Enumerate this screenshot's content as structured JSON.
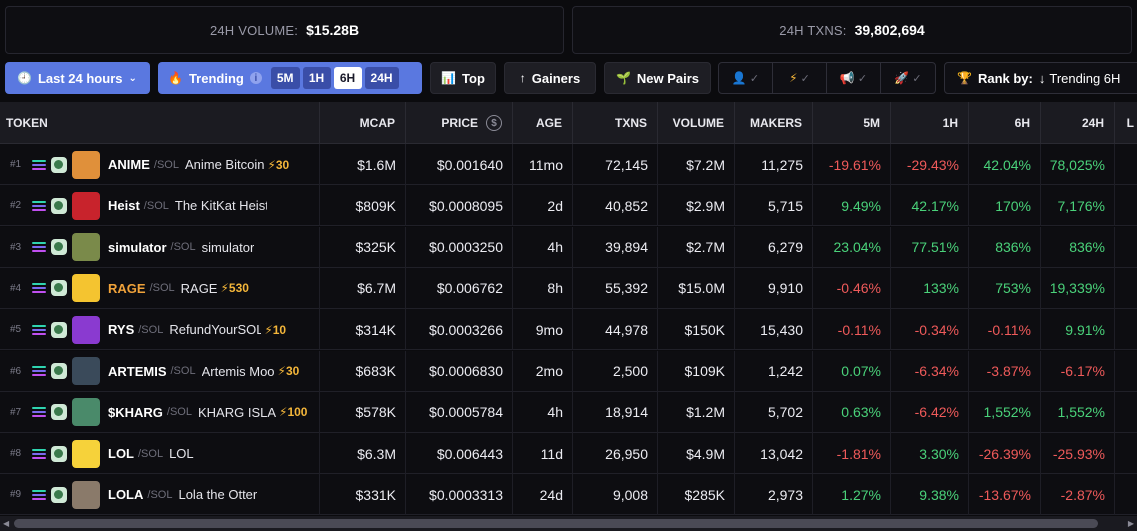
{
  "stats": {
    "volume_label": "24H VOLUME:",
    "volume_value": "$15.28B",
    "txns_label": "24H TXNS:",
    "txns_value": "39,802,694"
  },
  "toolbar": {
    "range_label": "Last 24 hours",
    "trending_label": "Trending",
    "trending_periods": [
      "5M",
      "1H",
      "6H",
      "24H"
    ],
    "trending_active": "6H",
    "top_label": "Top",
    "gainers_label": "Gainers",
    "new_pairs_label": "New Pairs",
    "rank_by_label": "Rank by:",
    "rank_by_value": "Trending 6H"
  },
  "table": {
    "columns": [
      "TOKEN",
      "MCAP",
      "PRICE",
      "AGE",
      "TXNS",
      "VOLUME",
      "MAKERS",
      "5M",
      "1H",
      "6H",
      "24H",
      "L"
    ],
    "rows": [
      {
        "rank": "#1",
        "symbol": "ANIME",
        "chain": "/SOL",
        "name": "Anime Bitcoin",
        "boost": "⚡30",
        "mcap": "$1.6M",
        "price": "$0.001640",
        "age": "11mo",
        "txns": "72,145",
        "volume": "$7.2M",
        "makers": "11,275",
        "m5": "-19.61%",
        "h1": "-29.43%",
        "h6": "42.04%",
        "h24": "78,025%",
        "avatar_color": "#e0903a"
      },
      {
        "rank": "#2",
        "symbol": "Heist",
        "chain": "/SOL",
        "name": "The KitKat Heist",
        "boost": "",
        "mcap": "$809K",
        "price": "$0.0008095",
        "age": "2d",
        "txns": "40,852",
        "volume": "$2.9M",
        "makers": "5,715",
        "m5": "9.49%",
        "h1": "42.17%",
        "h6": "170%",
        "h24": "7,176%",
        "avatar_color": "#c8232c"
      },
      {
        "rank": "#3",
        "symbol": "simulator",
        "chain": "/SOL",
        "name": "simulator",
        "boost": "",
        "mcap": "$325K",
        "price": "$0.0003250",
        "age": "4h",
        "txns": "39,894",
        "volume": "$2.7M",
        "makers": "6,279",
        "m5": "23.04%",
        "h1": "77.51%",
        "h6": "836%",
        "h24": "836%",
        "avatar_color": "#7a8a4a"
      },
      {
        "rank": "#4",
        "symbol": "RAGE",
        "chain": "/SOL",
        "name": "RAGE",
        "boost": "⚡530",
        "mcap": "$6.7M",
        "price": "$0.006762",
        "age": "8h",
        "txns": "55,392",
        "volume": "$15.0M",
        "makers": "9,910",
        "m5": "-0.46%",
        "h1": "133%",
        "h6": "753%",
        "h24": "19,339%",
        "avatar_color": "#f4c430"
      },
      {
        "rank": "#5",
        "symbol": "RYS",
        "chain": "/SOL",
        "name": "RefundYourSOL",
        "boost": "⚡10",
        "mcap": "$314K",
        "price": "$0.0003266",
        "age": "9mo",
        "txns": "44,978",
        "volume": "$150K",
        "makers": "15,430",
        "m5": "-0.11%",
        "h1": "-0.34%",
        "h6": "-0.11%",
        "h24": "9.91%",
        "avatar_color": "#8a3ad0"
      },
      {
        "rank": "#6",
        "symbol": "ARTEMIS",
        "chain": "/SOL",
        "name": "Artemis Moo",
        "boost": "⚡30",
        "mcap": "$683K",
        "price": "$0.0006830",
        "age": "2mo",
        "txns": "2,500",
        "volume": "$109K",
        "makers": "1,242",
        "m5": "0.07%",
        "h1": "-6.34%",
        "h6": "-3.87%",
        "h24": "-6.17%",
        "avatar_color": "#3a4a5a"
      },
      {
        "rank": "#7",
        "symbol": "$KHARG",
        "chain": "/SOL",
        "name": "KHARG ISLA",
        "boost": "⚡100",
        "mcap": "$578K",
        "price": "$0.0005784",
        "age": "4h",
        "txns": "18,914",
        "volume": "$1.2M",
        "makers": "5,702",
        "m5": "0.63%",
        "h1": "-6.42%",
        "h6": "1,552%",
        "h24": "1,552%",
        "avatar_color": "#4a8a6a"
      },
      {
        "rank": "#8",
        "symbol": "LOL",
        "chain": "/SOL",
        "name": "LOL",
        "boost": "",
        "mcap": "$6.3M",
        "price": "$0.006443",
        "age": "11d",
        "txns": "26,950",
        "volume": "$4.9M",
        "makers": "13,042",
        "m5": "-1.81%",
        "h1": "3.30%",
        "h6": "-26.39%",
        "h24": "-25.93%",
        "avatar_color": "#f6d23a"
      },
      {
        "rank": "#9",
        "symbol": "LOLA",
        "chain": "/SOL",
        "name": "Lola the Otter",
        "boost": "",
        "mcap": "$331K",
        "price": "$0.0003313",
        "age": "24d",
        "txns": "9,008",
        "volume": "$285K",
        "makers": "2,973",
        "m5": "1.27%",
        "h1": "9.38%",
        "h6": "-13.67%",
        "h24": "-2.87%",
        "avatar_color": "#8a7a6a"
      }
    ]
  },
  "colors": {
    "positive": "#4ad27a",
    "negative": "#ef5a5a",
    "accent": "#5a78e0",
    "boost": "#f4b63a"
  }
}
